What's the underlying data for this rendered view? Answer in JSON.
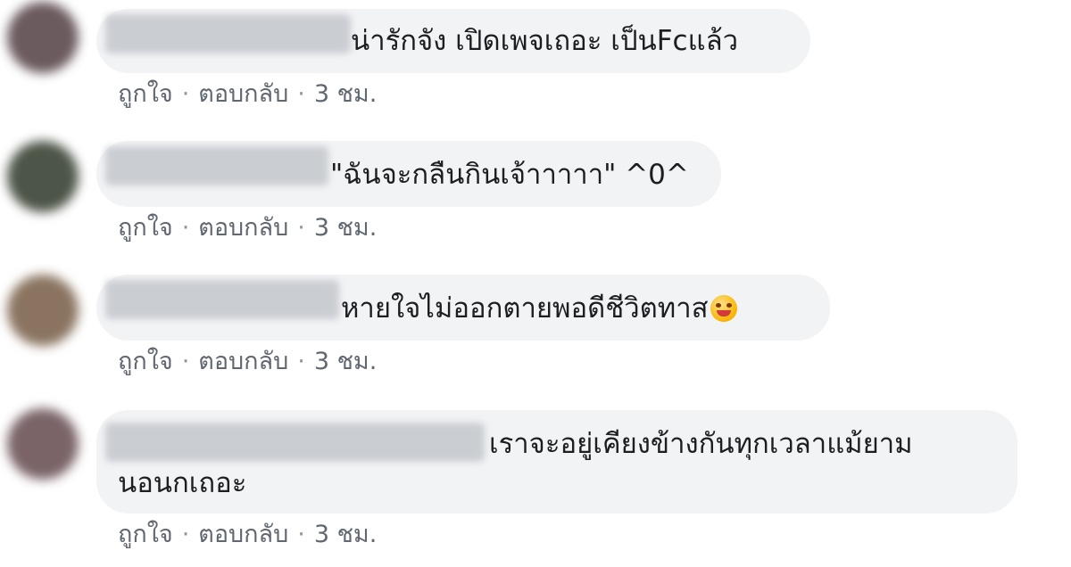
{
  "comments": [
    {
      "text": "น่ารักจัง เปิดเพจเถอะ เป็นFcแล้ว",
      "like": "ถูกใจ",
      "reply": "ตอบกลับ",
      "time": "3 ชม.",
      "avatar_color": "#6b5a5e"
    },
    {
      "text": "\"ฉันจะกลืนกินเจ้าาาาา\" ^0^",
      "like": "ถูกใจ",
      "reply": "ตอบกลับ",
      "time": "3 ชม.",
      "avatar_color": "#4d5548"
    },
    {
      "text": "หายใจไม่ออกตายพอดีชีวิตทาส",
      "emoji": "drooling-face-emoji",
      "like": "ถูกใจ",
      "reply": "ตอบกลับ",
      "time": "3 ชม.",
      "avatar_color": "#8a7460"
    },
    {
      "text_line1": "เราจะอยู่เคียงข้างกันทุกเวลาแม้ยาม",
      "text_line2": "นอนกเถอะ",
      "like": "ถูกใจ",
      "reply": "ตอบกลับ",
      "time": "3 ชม.",
      "avatar_color": "#7a6468"
    }
  ],
  "separator": "·",
  "colors": {
    "bubble": "#f2f3f5",
    "text": "#1c1e21",
    "meta": "#606770"
  }
}
